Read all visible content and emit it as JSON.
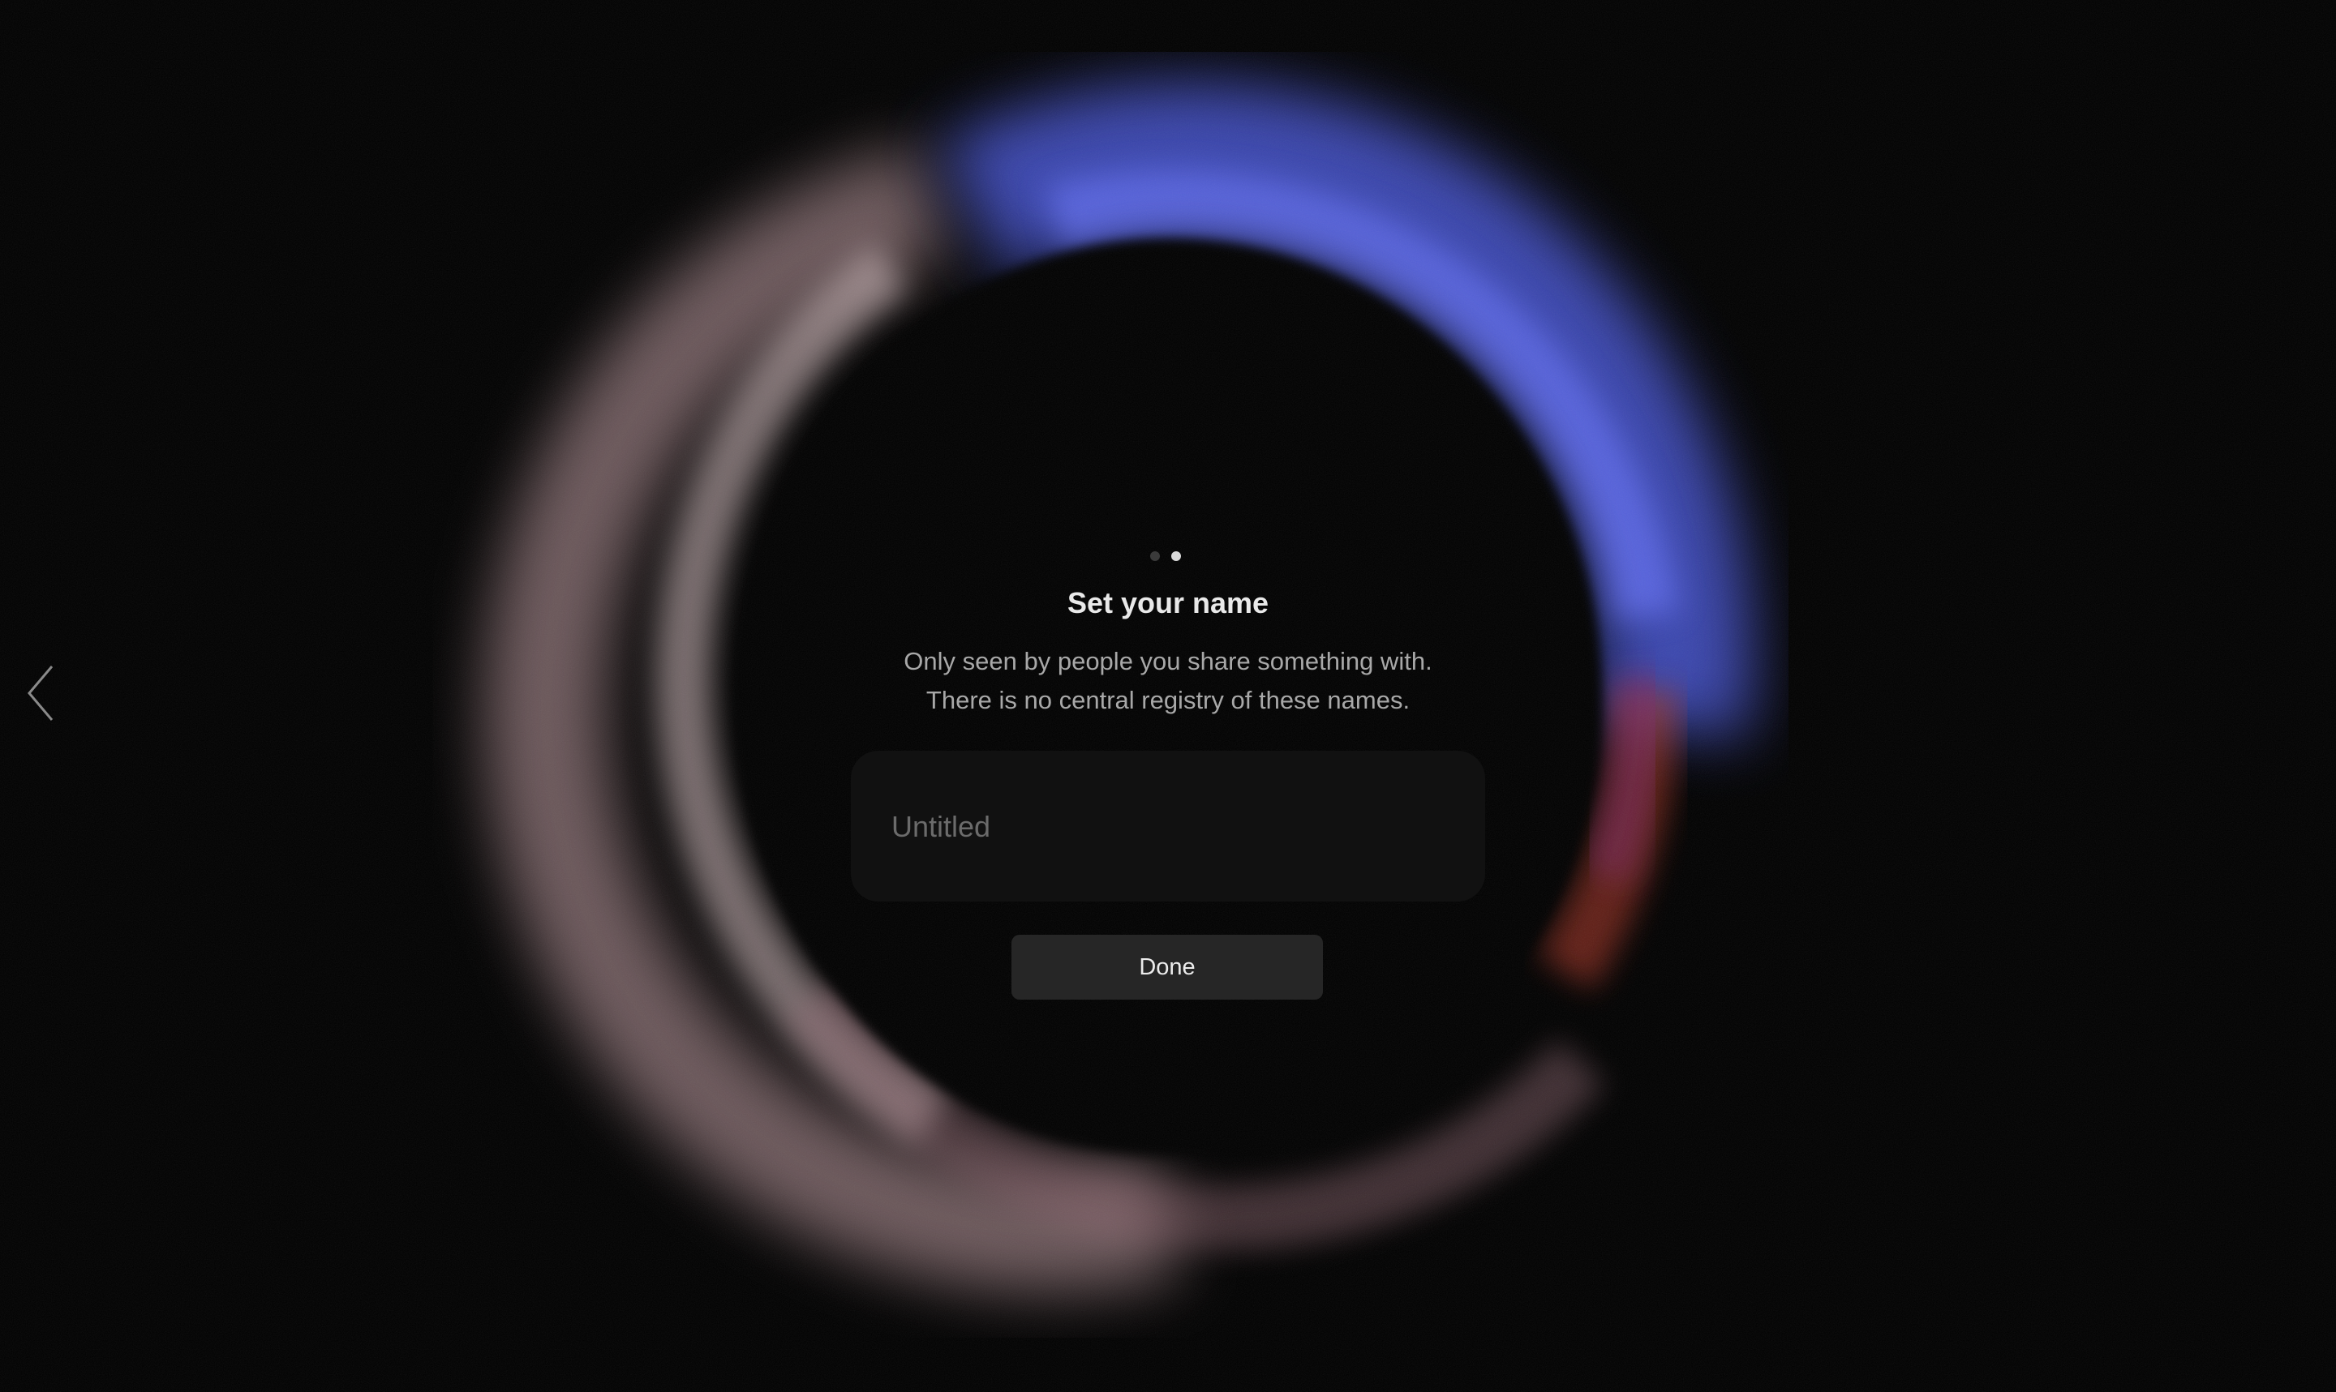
{
  "onboarding": {
    "title": "Set your name",
    "subtitle_line1": "Only seen by people you share something with.",
    "subtitle_line2": "There is no central registry of these names.",
    "steps_total": 2,
    "current_step": 2
  },
  "name_field": {
    "placeholder": "Untitled",
    "value": ""
  },
  "actions": {
    "done_label": "Done"
  },
  "navigation": {
    "back_icon": "chevron-left-icon"
  },
  "colors": {
    "background": "#000000",
    "ring_blue": "#5a66e0",
    "ring_pink": "#c9a6ac",
    "ring_red": "#a0302a"
  }
}
